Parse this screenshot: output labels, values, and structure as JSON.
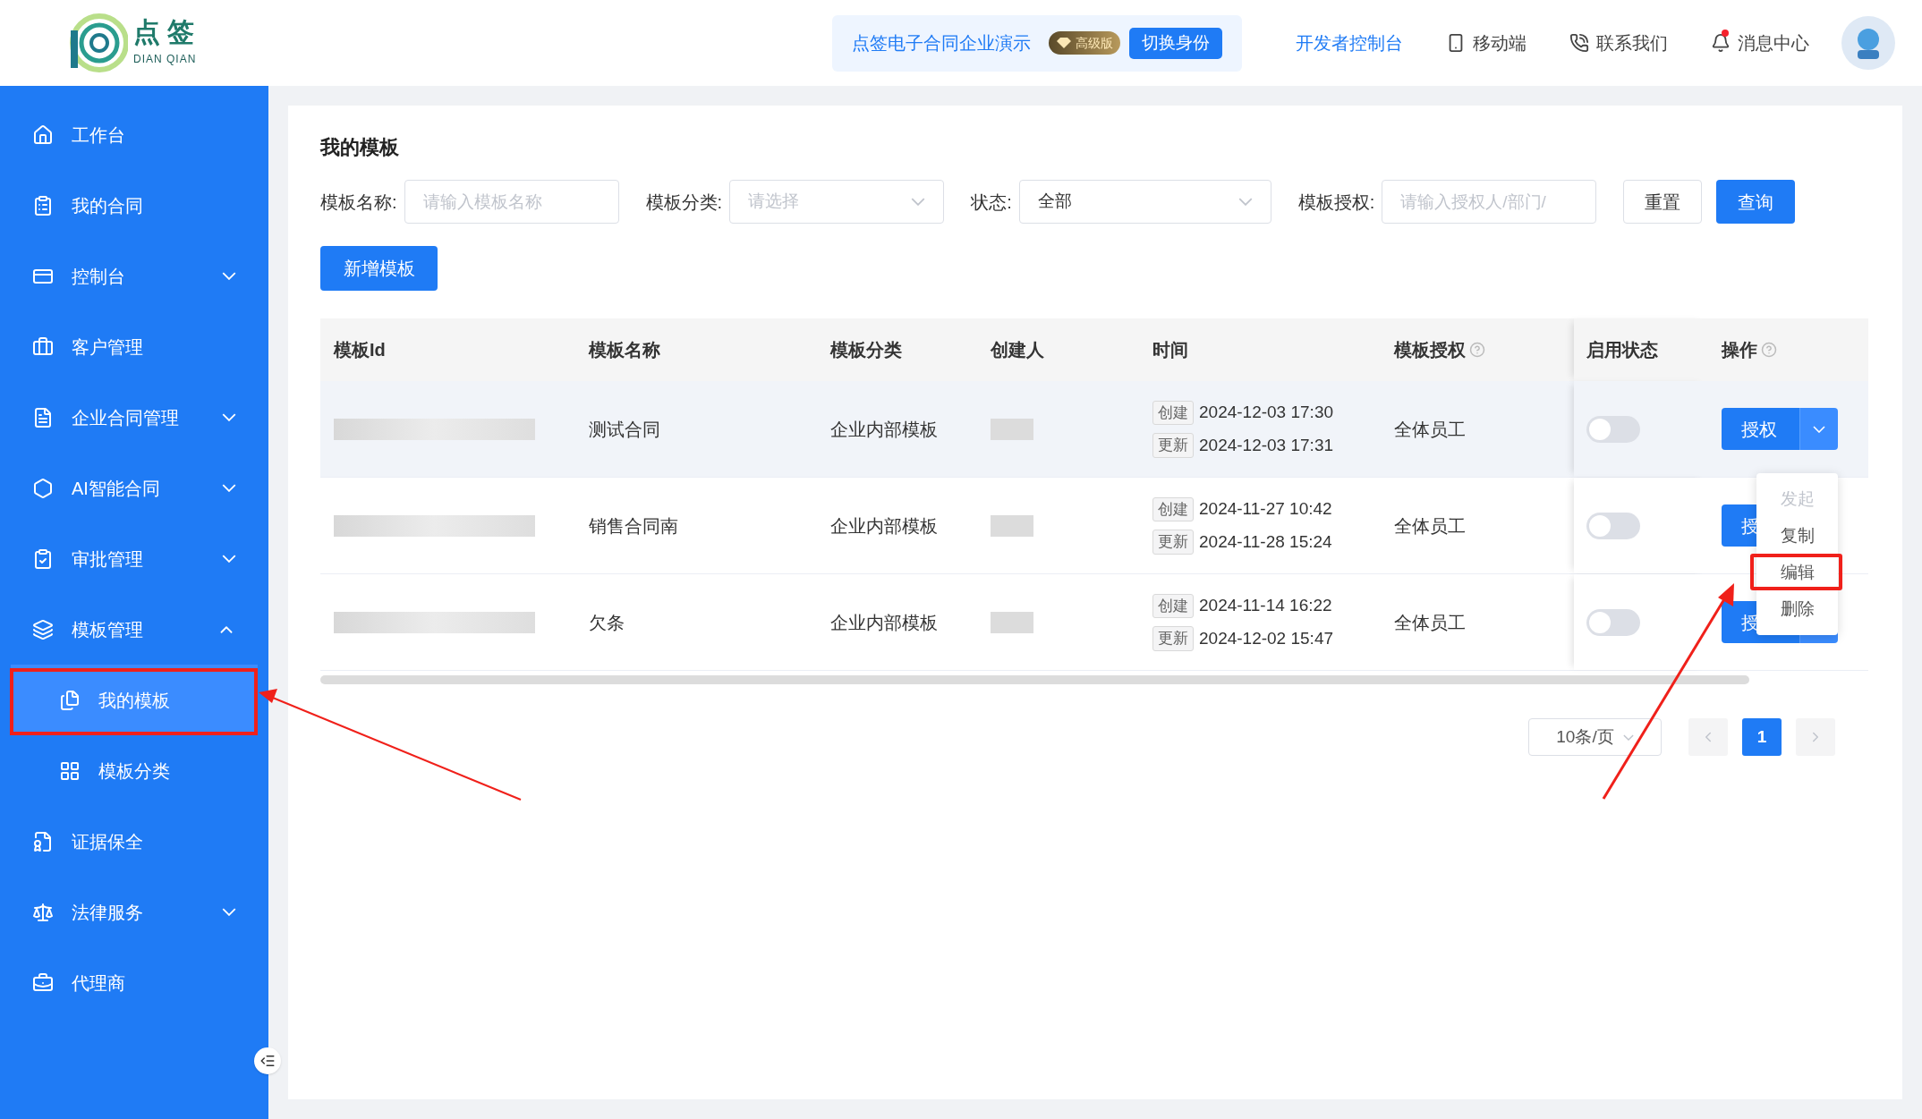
{
  "header": {
    "logo_title": "点 签",
    "logo_subtitle": "DIAN QIAN",
    "company": "点签电子合同企业演示",
    "plan_badge": "高级版",
    "switch_button": "切换身份",
    "links": [
      {
        "label": "开发者控制台",
        "kind": "primary"
      },
      {
        "label": "移动端",
        "kind": "mobile"
      },
      {
        "label": "联系我们",
        "kind": "contact"
      },
      {
        "label": "消息中心",
        "kind": "messages",
        "unread": true
      }
    ]
  },
  "sidebar": {
    "items": [
      {
        "label": "工作台",
        "expandable": false
      },
      {
        "label": "我的合同",
        "expandable": false
      },
      {
        "label": "控制台",
        "expandable": true,
        "expanded": false
      },
      {
        "label": "客户管理",
        "expandable": false
      },
      {
        "label": "企业合同管理",
        "expandable": true,
        "expanded": false
      },
      {
        "label": "AI智能合同",
        "expandable": true,
        "expanded": false
      },
      {
        "label": "审批管理",
        "expandable": true,
        "expanded": false
      },
      {
        "label": "模板管理",
        "expandable": true,
        "expanded": true,
        "children": [
          {
            "label": "我的模板",
            "selected": true
          },
          {
            "label": "模板分类",
            "selected": false
          }
        ]
      },
      {
        "label": "证据保全",
        "expandable": false
      },
      {
        "label": "法律服务",
        "expandable": true,
        "expanded": false
      },
      {
        "label": "代理商",
        "expandable": false
      }
    ]
  },
  "page": {
    "title": "我的模板",
    "filters": [
      {
        "label": "模板名称:",
        "kind": "input",
        "placeholder": "请输入模板名称"
      },
      {
        "label": "模板分类:",
        "kind": "select",
        "placeholder": "请选择"
      },
      {
        "label": "状态:",
        "kind": "select",
        "value": "全部"
      },
      {
        "label": "模板授权:",
        "kind": "input",
        "placeholder": "请输入授权人/部门/"
      }
    ],
    "reset_button": "重置",
    "query_button": "查询",
    "add_button": "新增模板",
    "table": {
      "columns": [
        {
          "label": "模板Id"
        },
        {
          "label": "模板名称"
        },
        {
          "label": "模板分类"
        },
        {
          "label": "创建人"
        },
        {
          "label": "时间"
        },
        {
          "label": "模板授权",
          "help": true
        },
        {
          "label": "启用状态"
        },
        {
          "label": "操作",
          "help": true
        }
      ],
      "rows": [
        {
          "name": "测试合同",
          "category": "企业内部模板",
          "times": [
            {
              "tag": "创建",
              "value": "2024-12-03 17:30"
            },
            {
              "tag": "更新",
              "value": "2024-12-03 17:31"
            }
          ],
          "authorization": "全体员工",
          "enabled": false,
          "action": "授权",
          "highlighted": true,
          "menu": [
            {
              "label": "发起",
              "disabled": true
            },
            {
              "label": "复制",
              "disabled": false
            },
            {
              "label": "编辑",
              "disabled": false
            },
            {
              "label": "删除",
              "disabled": false
            }
          ]
        },
        {
          "name": "销售合同南",
          "category": "企业内部模板",
          "times": [
            {
              "tag": "创建",
              "value": "2024-11-27 10:42"
            },
            {
              "tag": "更新",
              "value": "2024-11-28 15:24"
            }
          ],
          "authorization": "全体员工",
          "enabled": false,
          "action": "授",
          "highlighted": false
        },
        {
          "name": "欠条",
          "category": "企业内部模板",
          "times": [
            {
              "tag": "创建",
              "value": "2024-11-14 16:22"
            },
            {
              "tag": "更新",
              "value": "2024-12-02 15:47"
            }
          ],
          "authorization": "全体员工",
          "enabled": false,
          "action": "授",
          "highlighted": false
        }
      ]
    },
    "pagination": {
      "page_size": "10条/页",
      "pages": [
        {
          "label": "1",
          "selected": true
        }
      ]
    }
  }
}
